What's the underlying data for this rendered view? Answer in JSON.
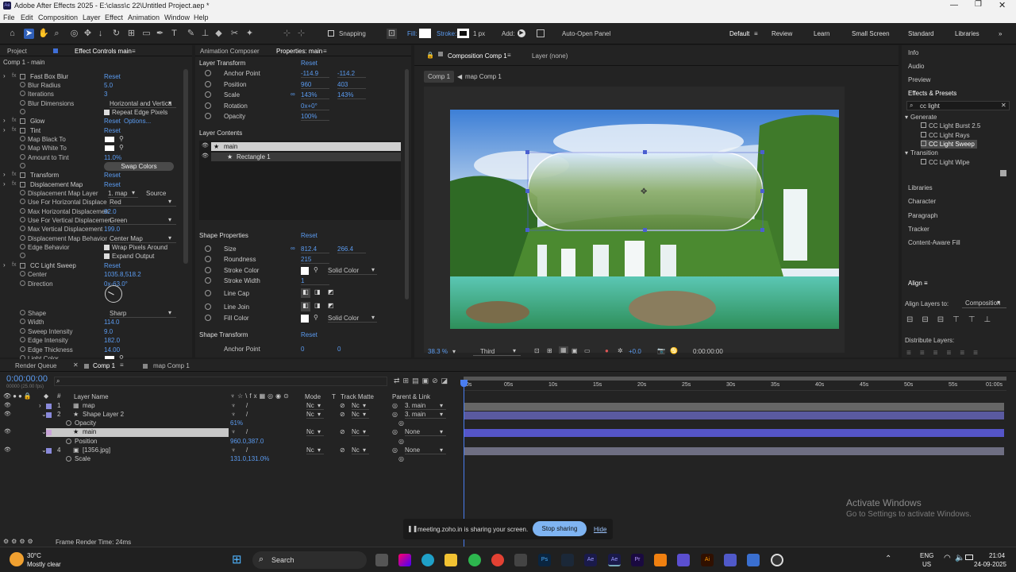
{
  "app": {
    "title": "Adobe After Effects 2025 - E:\\class\\c 22\\Untitled Project.aep *"
  },
  "menu": [
    "File",
    "Edit",
    "Composition",
    "Layer",
    "Effect",
    "Animation",
    "Window",
    "Help"
  ],
  "toolbar": {
    "snapping": "Snapping",
    "fill_label": "Fill:",
    "stroke_label": "Stroke:",
    "stroke_width": "1 px",
    "add_label": "Add:",
    "auto_open": "Auto-Open Panel",
    "workspaces": [
      "Default",
      "Review",
      "Learn",
      "Small Screen",
      "Standard",
      "Libraries"
    ]
  },
  "left_panel": {
    "tabs": [
      "Project",
      "Effect Controls main"
    ],
    "header": "Comp 1 - main",
    "effects": [
      {
        "name": "Fast Box Blur",
        "value": "Reset",
        "fx": true
      },
      {
        "name": "Blur Radius",
        "value": "5.0"
      },
      {
        "name": "Iterations",
        "value": "3"
      },
      {
        "name": "Blur Dimensions",
        "value": "Horizontal and Vertica"
      },
      {
        "name": "",
        "value": "Repeat Edge Pixels"
      },
      {
        "name": "Glow",
        "value": "Reset",
        "extra": "Options...",
        "fx": true
      },
      {
        "name": "Tint",
        "value": "Reset",
        "fx": true
      },
      {
        "name": "Map Black To",
        "value": ""
      },
      {
        "name": "Map White To",
        "value": ""
      },
      {
        "name": "Amount to Tint",
        "value": "11.0%"
      },
      {
        "name": "",
        "value": "Swap Colors"
      },
      {
        "name": "Transform",
        "value": "Reset",
        "fx": true
      },
      {
        "name": "Displacement Map",
        "value": "Reset",
        "fx": true
      },
      {
        "name": "Displacement Map Layer",
        "value": "1. map",
        "extra": "Source"
      },
      {
        "name": "Use For Horizontal Displace",
        "value": "Red"
      },
      {
        "name": "Max Horizontal Displacemen",
        "value": "82.0"
      },
      {
        "name": "Use For Vertical Displacemen",
        "value": "Green"
      },
      {
        "name": "Max Vertical Displacement",
        "value": "199.0"
      },
      {
        "name": "Displacement Map Behavior",
        "value": "Center Map"
      },
      {
        "name": "Edge Behavior",
        "value": "Wrap Pixels Around"
      },
      {
        "name": "",
        "value": "Expand Output"
      },
      {
        "name": "CC Light Sweep",
        "value": "Reset",
        "fx": true
      },
      {
        "name": "Center",
        "value": "1035.8,518.2"
      },
      {
        "name": "Direction",
        "value": "0x-63.0°"
      },
      {
        "name": "Shape",
        "value": "Sharp"
      },
      {
        "name": "Width",
        "value": "114.0"
      },
      {
        "name": "Sweep Intensity",
        "value": "9.0"
      },
      {
        "name": "Edge Intensity",
        "value": "182.0"
      },
      {
        "name": "Edge Thickness",
        "value": "14.00"
      },
      {
        "name": "Light Color",
        "value": ""
      }
    ]
  },
  "props_panel": {
    "tabs": [
      "Animation Composer",
      "Properties: main"
    ],
    "layer_transform": "Layer Transform",
    "reset": "Reset",
    "transform": [
      {
        "name": "Anchor Point",
        "v1": "-114.9",
        "v2": "-114.2"
      },
      {
        "name": "Position",
        "v1": "960",
        "v2": "403"
      },
      {
        "name": "Scale",
        "v1": "143%",
        "v2": "143%"
      },
      {
        "name": "Rotation",
        "v1": "0x+0°",
        "v2": ""
      },
      {
        "name": "Opacity",
        "v1": "100%",
        "v2": ""
      }
    ],
    "layer_contents": "Layer Contents",
    "contents": [
      "main",
      "Rectangle 1"
    ],
    "shape_properties": "Shape Properties",
    "shape": [
      {
        "name": "Size",
        "v1": "812.4",
        "v2": "266.4"
      },
      {
        "name": "Roundness",
        "v1": "215",
        "v2": ""
      },
      {
        "name": "Stroke Color",
        "v1": "",
        "v2": "Solid Color"
      },
      {
        "name": "Stroke Width",
        "v1": "1",
        "v2": ""
      },
      {
        "name": "Line Cap",
        "v1": "",
        "v2": ""
      },
      {
        "name": "Line Join",
        "v1": "",
        "v2": ""
      },
      {
        "name": "Fill Color",
        "v1": "",
        "v2": "Solid Color"
      }
    ],
    "shape_transform": "Shape Transform",
    "shape_anchor": {
      "name": "Anchor Point",
      "v1": "0",
      "v2": "0"
    }
  },
  "comp": {
    "tab": "Composition Comp 1",
    "layer_tab": "Layer (none)",
    "breadcrumbs": [
      "Comp 1",
      "map Comp 1"
    ],
    "zoom": "38.3",
    "zoom_unit": "%",
    "quality": "Third",
    "exposure": "+0.0",
    "timecode": "0:00:00:00"
  },
  "right_panel": {
    "items_top": [
      "Info",
      "Audio",
      "Preview",
      "Effects & Presets"
    ],
    "search": "cc light",
    "tree": [
      {
        "label": "Generate",
        "level": 0
      },
      {
        "label": "CC Light Burst 2.5",
        "level": 1
      },
      {
        "label": "CC Light Rays",
        "level": 1
      },
      {
        "label": "CC Light Sweep",
        "level": 1
      },
      {
        "label": "Transition",
        "level": 0
      },
      {
        "label": "CC Light Wipe",
        "level": 1
      }
    ],
    "items_bottom": [
      "Libraries",
      "Character",
      "Paragraph",
      "Tracker",
      "Content-Aware Fill"
    ],
    "align": "Align",
    "align_to_label": "Align Layers to:",
    "align_to": "Composition",
    "distribute": "Distribute Layers:"
  },
  "timeline": {
    "tabs": [
      "Render Queue",
      "Comp 1",
      "map Comp 1"
    ],
    "timecode": "0:00:00:00",
    "fps": "00000 (25.00 fps)",
    "cols": {
      "layer_name": "Layer Name",
      "mode": "Mode",
      "t": "T",
      "track_matte": "Track Matte",
      "parent": "Parent & Link"
    },
    "ruler": [
      "0s",
      "05s",
      "10s",
      "15s",
      "20s",
      "25s",
      "30s",
      "35s",
      "40s",
      "45s",
      "50s",
      "55s",
      "01:00s"
    ],
    "layers": [
      {
        "num": "1",
        "name": "map",
        "mode": "Nc",
        "matte": "Nc",
        "parent": "3. main"
      },
      {
        "num": "2",
        "name": "Shape Layer 2",
        "mode": "Nc",
        "matte": "Nc",
        "parent": "3. main"
      },
      {
        "num": "",
        "name": "Opacity",
        "value": "61%"
      },
      {
        "num": "3",
        "name": "main",
        "mode": "Nc",
        "matte": "Nc",
        "parent": "None"
      },
      {
        "num": "",
        "name": "Position",
        "value": "960.0,387.0"
      },
      {
        "num": "4",
        "name": "[1356.jpg]",
        "mode": "Nc",
        "matte": "Nc",
        "parent": "None"
      },
      {
        "num": "",
        "name": "Scale",
        "value": "131.0,131.0%"
      }
    ],
    "frame_render": "Frame Render Time:",
    "frame_render_value": "24ms"
  },
  "share": {
    "text": "meeting.zoho.in is sharing your screen.",
    "stop": "Stop sharing",
    "hide": "Hide"
  },
  "activate": {
    "title": "Activate Windows",
    "sub": "Go to Settings to activate Windows."
  },
  "taskbar": {
    "temp": "30°C",
    "weather": "Mostly clear",
    "search": "Search",
    "lang": "ENG",
    "region": "US",
    "time": "21:04",
    "date": "24-09-2025"
  }
}
